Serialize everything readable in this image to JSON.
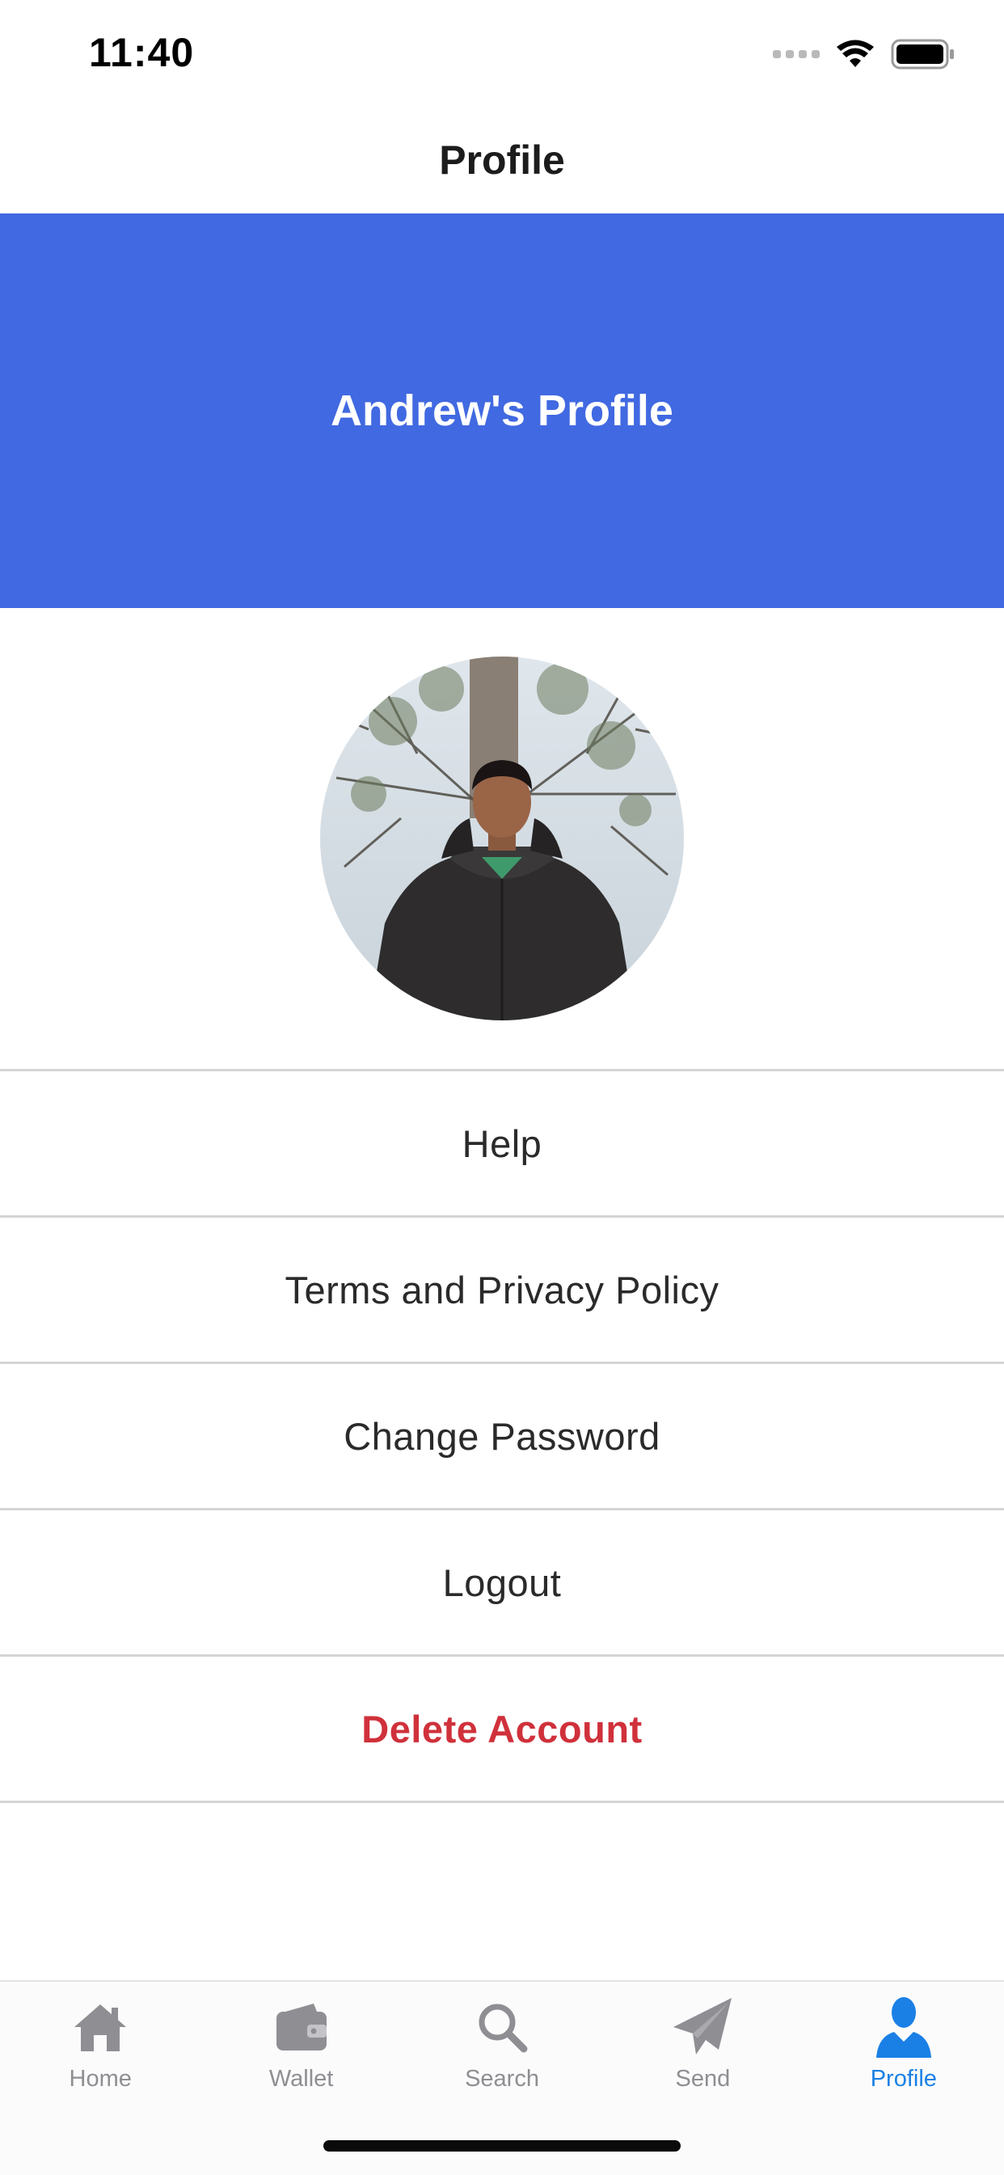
{
  "status_bar": {
    "time": "11:40"
  },
  "nav": {
    "title": "Profile"
  },
  "banner": {
    "title": "Andrew's Profile",
    "color": "#4169e1"
  },
  "avatar": {
    "description": "profile-photo"
  },
  "menu": {
    "items": [
      {
        "label": "Help"
      },
      {
        "label": "Terms and Privacy Policy"
      },
      {
        "label": "Change Password"
      },
      {
        "label": "Logout"
      },
      {
        "label": "Delete Account",
        "color": "#d0313b"
      }
    ]
  },
  "tab_bar": {
    "active_color": "#1a80e6",
    "inactive_color": "#8e8e93",
    "tabs": [
      {
        "label": "Home",
        "icon": "home-icon"
      },
      {
        "label": "Wallet",
        "icon": "wallet-icon"
      },
      {
        "label": "Search",
        "icon": "search-icon"
      },
      {
        "label": "Send",
        "icon": "send-icon"
      },
      {
        "label": "Profile",
        "icon": "profile-icon",
        "active": true
      }
    ]
  }
}
